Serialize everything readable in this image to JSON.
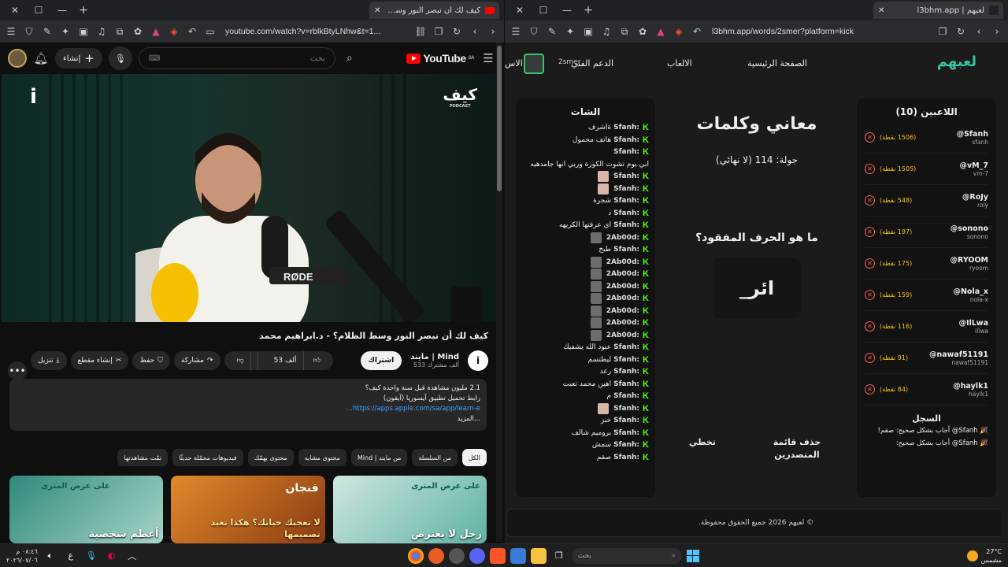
{
  "left_window": {
    "tab_title": "كيف لك أن تبصر النور وسط الظ...",
    "url": "youtube.com/watch?v=rblkBtyLNhw&t=1...",
    "youtube": {
      "logo_text": "YouTube",
      "region": "SA",
      "create_label": "إنشاء",
      "search_placeholder": "بحث",
      "video_logo_left": "i",
      "video_logo_right": "كيف",
      "video_logo_right_sub": "PODCAST",
      "video_title": "كيف لك أن تبصر النور وسط الظلام؟ - د.ابراهيم محمد",
      "channel_name": "مايند | Mind",
      "channel_subs": "533 ألف مشترك",
      "channel_avatar": "i",
      "subscribe_label": "اشتراك",
      "like_count": "53 ألف",
      "share_label": "مشاركة",
      "save_label": "حفظ",
      "clip_label": "إنشاء مقطع",
      "download_label": "تنزيل",
      "description_line1": "2.1 مليون مشاهدة  قبل سنة واحدة  كيف؟",
      "description_line2": "رابط تحميل تطبيق آيسوريا (آيفون)",
      "description_link": "https://apps.apple.com/sa/app/learn-e...",
      "description_more": "...المزيد",
      "chips": [
        "الكل",
        "من السلسلة",
        "من مايند | Mind",
        "محتوى مشابه",
        "محتوى يهمّك",
        "فيديوهات محمّلة حديثًا",
        "تمّت مشاهدتها"
      ],
      "thumbnails": [
        {
          "title": "رجل لا يعترض",
          "badge": "على عرض المترى"
        },
        {
          "title": "لا تعجبك حياتك؟ هكذا تعيد تصميمها",
          "badge": "فنجان"
        },
        {
          "title": "أعظم شخصية",
          "badge": "على عرض المترى"
        }
      ]
    }
  },
  "right_window": {
    "tab_title": "لعبهم | l3bhm.app",
    "url": "l3bhm.app/words/2smer?platform=kick",
    "nav": {
      "logo": "لعبهم",
      "home": "الصفحة الرئيسية",
      "games": "الالعاب",
      "support": "الدعم الفني",
      "user": "2smer",
      "more": "الاس"
    },
    "chat": {
      "title": "الشات",
      "messages": [
        {
          "user": "Sfanh:",
          "text": "ةاشرف"
        },
        {
          "user": "Sfanh:",
          "text": "هاتف محمول"
        },
        {
          "user": "Sfanh:",
          "text": ""
        },
        {
          "user": "",
          "text": "ابي يوم تشوت الكورة وربي انها جامدهيه"
        },
        {
          "user": "Sfanh:",
          "text": "",
          "emote": "light"
        },
        {
          "user": "Sfanh:",
          "text": "",
          "emote": "light"
        },
        {
          "user": "Sfanh:",
          "text": "شجرة"
        },
        {
          "user": "Sfanh:",
          "text": "د"
        },
        {
          "user": "Sfanh:",
          "text": "اي عرفتها الكريهه"
        },
        {
          "user": "2Ab00d:",
          "text": "",
          "emote": "dark"
        },
        {
          "user": "Sfanh:",
          "text": "طبخ"
        },
        {
          "user": "2Ab00d:",
          "text": "",
          "emote": "dark"
        },
        {
          "user": "2Ab00d:",
          "text": "",
          "emote": "dark"
        },
        {
          "user": "2Ab00d:",
          "text": "",
          "emote": "dark"
        },
        {
          "user": "2Ab00d:",
          "text": "",
          "emote": "dark"
        },
        {
          "user": "2Ab00d:",
          "text": "",
          "emote": "dark"
        },
        {
          "user": "2Ab00d:",
          "text": "",
          "emote": "dark"
        },
        {
          "user": "2Ab00d:",
          "text": "",
          "emote": "dark"
        },
        {
          "user": "Sfanh:",
          "text": "عبود الله يشفيك"
        },
        {
          "user": "Sfanh:",
          "text": "ليطتسم"
        },
        {
          "user": "Sfanh:",
          "text": "رعد"
        },
        {
          "user": "Sfanh:",
          "text": "اهين محمد تعبت"
        },
        {
          "user": "Sfanh:",
          "text": "م"
        },
        {
          "user": "Sfanh:",
          "text": "",
          "emote": "light"
        },
        {
          "user": "Sfanh:",
          "text": "خبز"
        },
        {
          "user": "Sfanh:",
          "text": "يروميم شالف"
        },
        {
          "user": "Sfanh:",
          "text": "سمش"
        },
        {
          "user": "Sfanh:",
          "text": "صقم"
        }
      ]
    },
    "game": {
      "title": "معاني وكلمات",
      "round": "جولة: 114 (لا نهائي)",
      "question": "ما هو الحرف المفقود؟",
      "word": "_ائر",
      "skip_label": "تخطي",
      "clear_leaderboard_label": "حذف قائمة المتصدرين"
    },
    "players": {
      "title": "اللاعبين (10)",
      "list": [
        {
          "name": "@Sfanh",
          "handle": "sfanh",
          "points": "(1506 نقطة)"
        },
        {
          "name": "@vM_7",
          "handle": "vm-7",
          "points": "(1505 نقطة)"
        },
        {
          "name": "@RoJy",
          "handle": "roly",
          "points": "(548 نقطة)"
        },
        {
          "name": "@sonono",
          "handle": "sonono",
          "points": "(197 نقطة)"
        },
        {
          "name": "@RYOOM",
          "handle": "ryoom",
          "points": "(175 نقطة)"
        },
        {
          "name": "@Nola_x",
          "handle": "nola-x",
          "points": "(159 نقطة)"
        },
        {
          "name": "@IlLwa",
          "handle": "illwa",
          "points": "(116 نقطة)"
        },
        {
          "name": "@nawaf51191",
          "handle": "nawaf51191",
          "points": "(91 نقطة)"
        },
        {
          "name": "@haylk1",
          "handle": "haylk1",
          "points": "(84 نقطة)"
        }
      ],
      "log_title": "السجل",
      "log": [
        "🎉 Sfanh@ أجاب بشكل صحيح: صقم!",
        "🎉 Sfanh@ أجاب بشكل صحيح:"
      ]
    },
    "footer": "© لعبهم 2026 جميع الحقوق محفوظة."
  },
  "taskbar": {
    "time": "٠٨:٤٦ م",
    "date": "٢٠٢٦/٠٧/٠٦",
    "lang": "ع",
    "search_placeholder": "بحث",
    "temperature": "27°C",
    "weather": "مشمس"
  }
}
